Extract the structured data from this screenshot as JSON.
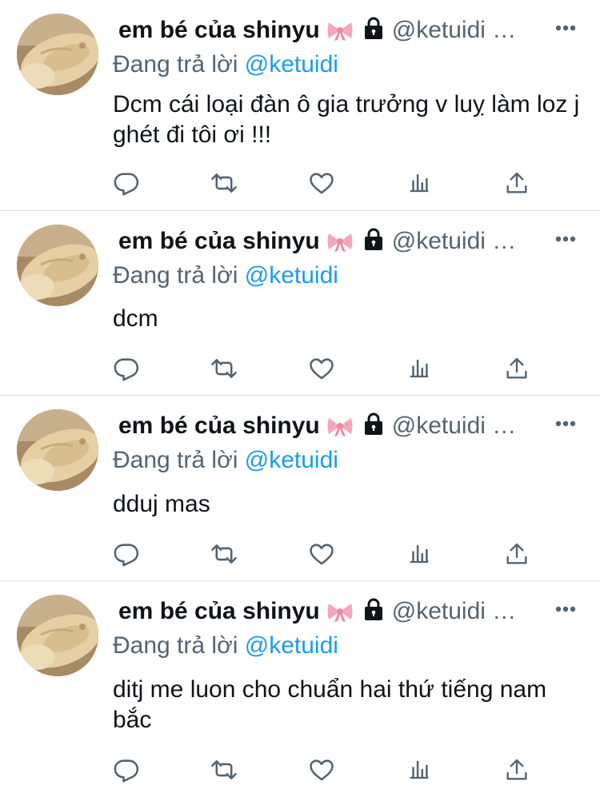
{
  "tweets": [
    {
      "name": "em bé của shinyu",
      "handle": "@ketuidi …",
      "reply_prefix": "Đang trả lời",
      "reply_to": "@ketuidi",
      "text": "Dcm cái loại đàn ô gia trưởng v luỵ làm loz j ghét đi tôi ơi !!!"
    },
    {
      "name": "em bé của shinyu",
      "handle": "@ketuidi …",
      "reply_prefix": "Đang trả lời",
      "reply_to": "@ketuidi",
      "text": "dcm"
    },
    {
      "name": "em bé của shinyu",
      "handle": "@ketuidi …",
      "reply_prefix": "Đang trả lời",
      "reply_to": "@ketuidi",
      "text": "dduj mas"
    },
    {
      "name": "em bé của shinyu",
      "handle": "@ketuidi …",
      "reply_prefix": "Đang trả lời",
      "reply_to": "@ketuidi",
      "text": "ditj me luon cho chuẩn hai thứ tiếng nam bắc"
    }
  ],
  "icons": {
    "name_emoji": "ribbon-bow-icon",
    "protected": "lock-icon",
    "menu": "more-icon",
    "actions": [
      "reply-icon",
      "retweet-icon",
      "like-icon",
      "analytics-icon",
      "share-icon"
    ]
  },
  "colors": {
    "text": "#0f1419",
    "secondary": "#536471",
    "link": "#1d9bf0",
    "divider": "#dcdfe3",
    "bow": "#f4a7bb"
  }
}
